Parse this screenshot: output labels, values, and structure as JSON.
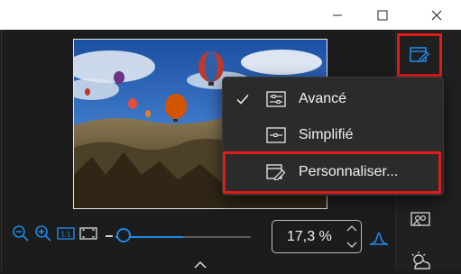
{
  "window": {
    "minimize_icon": "minimize-icon",
    "maximize_icon": "maximize-icon",
    "close_icon": "close-icon"
  },
  "thumbnail": {
    "subject": "hot-air balloons over rocky valley"
  },
  "right_rail": {
    "panel_toggle_icon": "edit-panel-icon",
    "icons": [
      "landscape-portrait-icon",
      "weather-icon"
    ]
  },
  "menu": {
    "items": [
      {
        "label": "Avancé",
        "checked": true,
        "icon": "advanced-sliders-icon"
      },
      {
        "label": "Simplifié",
        "checked": false,
        "icon": "simplified-sliders-icon"
      },
      {
        "label": "Personnaliser...",
        "checked": false,
        "icon": "customize-pencil-icon"
      }
    ]
  },
  "zoom": {
    "value": "17,3 %",
    "slider_fraction": 0.1,
    "tools": [
      "zoom-out-icon",
      "zoom-in-icon",
      "actual-size-icon",
      "fit-to-window-icon"
    ],
    "histogram_icon": "histogram-icon"
  },
  "colors": {
    "accent": "#1e88e5",
    "highlight": "#e11b1b",
    "background": "#1c1c1c",
    "menu_bg": "#2b2b2b"
  }
}
